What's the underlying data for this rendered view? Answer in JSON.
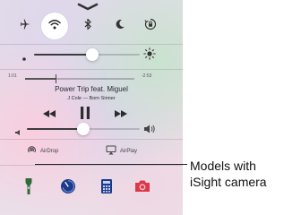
{
  "control_center": {
    "toggles": [
      {
        "icon": "airplane-icon",
        "on": false
      },
      {
        "icon": "wifi-icon",
        "on": true
      },
      {
        "icon": "bluetooth-icon",
        "on": false
      },
      {
        "icon": "moon-icon",
        "on": false
      },
      {
        "icon": "rotation-lock-icon",
        "on": false
      }
    ],
    "brightness": {
      "level": 0.55
    },
    "music": {
      "elapsed": "1:01",
      "remaining": "-2:53",
      "progress": 0.28,
      "title": "Power Trip feat. Miguel",
      "artist_album": "J Cole — Born Sinner"
    },
    "volume": {
      "level": 0.5
    },
    "airdrop_label": "AirDrop",
    "airplay_label": "AirPlay",
    "quick_actions": [
      {
        "icon": "flashlight-icon"
      },
      {
        "icon": "timer-icon"
      },
      {
        "icon": "calculator-icon"
      },
      {
        "icon": "camera-icon"
      }
    ],
    "colors": {
      "accent_red": "#d93a4a",
      "accent_blue": "#1c3a8a",
      "flashlight_green": "#2f6b3a"
    }
  },
  "annotation": {
    "line1": "Models with",
    "line2": "iSight camera"
  }
}
